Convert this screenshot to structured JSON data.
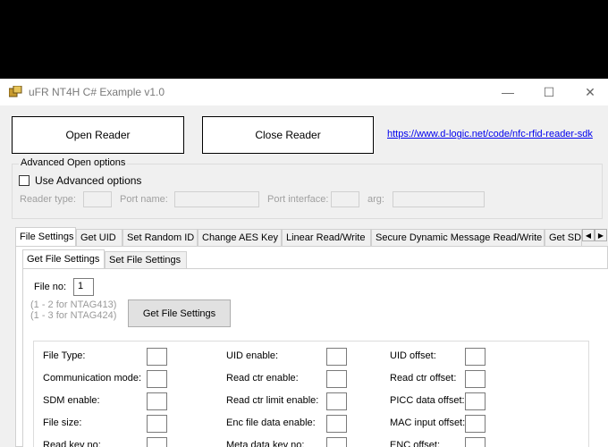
{
  "window": {
    "title": "uFR NT4H C# Example v1.0",
    "minimize": "—",
    "maximize": "☐",
    "close": "✕"
  },
  "top": {
    "open_reader": "Open Reader",
    "close_reader": "Close Reader",
    "link": "https://www.d-logic.net/code/nfc-rfid-reader-sdk"
  },
  "advanced": {
    "group_title": "Advanced Open options",
    "use_advanced": "Use Advanced options",
    "use_advanced_checked": false,
    "reader_type": "Reader type:",
    "port_name": "Port name:",
    "port_interface": "Port interface:",
    "arg": "arg:"
  },
  "tabs": [
    "File Settings",
    "Get UID",
    "Set Random ID",
    "Change AES Key",
    "Linear Read/Write",
    "Secure Dynamic Message Read/Write",
    "Get SD"
  ],
  "tab_scroll": {
    "left": "◀",
    "right": "▶"
  },
  "subtabs": [
    "Get File Settings",
    "Set File Settings"
  ],
  "file_settings": {
    "file_no_label": "File no:",
    "file_no_value": "1",
    "hint1": "(1 - 2 for NTAG413)",
    "hint2": "(1 - 3 for NTAG424)",
    "get_button": "Get File Settings"
  },
  "fields": {
    "col1": [
      "File Type:",
      "Communication mode:",
      "SDM enable:",
      "File size:",
      "Read key no:"
    ],
    "col2": [
      "UID enable:",
      "Read ctr enable:",
      "Read ctr limit enable:",
      "Enc file data enable:",
      "Meta data key no:"
    ],
    "col3": [
      "UID offset:",
      "Read ctr offset:",
      "PICC data offset:",
      "MAC input offset:",
      "ENC offset:"
    ]
  }
}
